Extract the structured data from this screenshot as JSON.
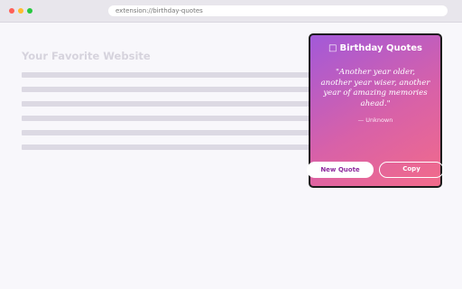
{
  "browser": {
    "url": "extension://birthday-quotes"
  },
  "page": {
    "title": "Your Favorite Website"
  },
  "popup": {
    "icon": "cake-icon",
    "title": "Birthday Quotes",
    "quote": "\"Another year older, another year wiser, another year of amazing memories ahead.\"",
    "author": "— Unknown",
    "new_quote_label": "New Quote",
    "copy_label": "Copy"
  },
  "colors": {
    "gradient_start": "#a259d9",
    "gradient_end": "#f26b8a",
    "accent_text": "#8d2a9e"
  }
}
